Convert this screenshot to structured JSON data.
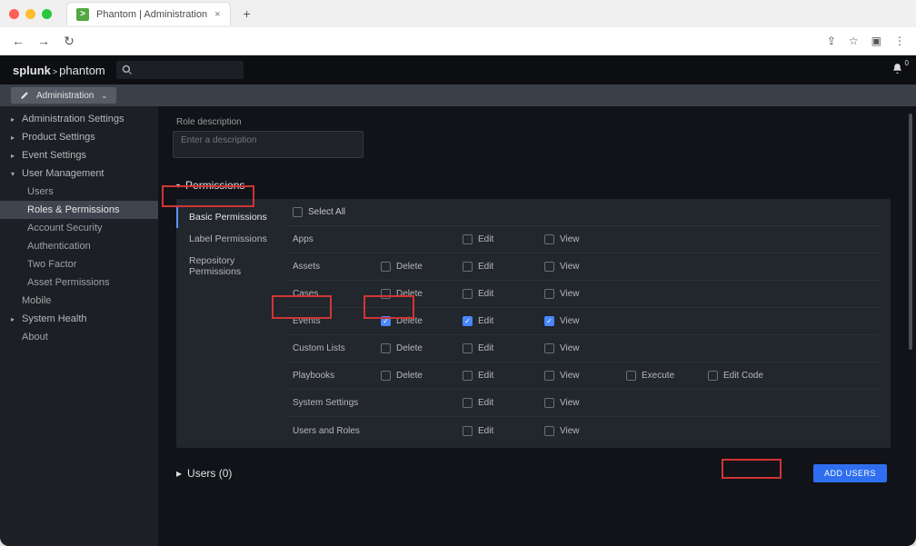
{
  "browser": {
    "tab_title": "Phantom | Administration",
    "favicon_char": ">"
  },
  "header": {
    "logo_a": "splunk",
    "logo_b": "phantom",
    "bell_count": "0"
  },
  "crumb": {
    "label": "Administration"
  },
  "sidebar": {
    "admin_settings": "Administration Settings",
    "product_settings": "Product Settings",
    "event_settings": "Event Settings",
    "user_mgmt": "User Management",
    "users": "Users",
    "roles": "Roles & Permissions",
    "acct_sec": "Account Security",
    "auth": "Authentication",
    "two_factor": "Two Factor",
    "asset_perm": "Asset Permissions",
    "mobile": "Mobile",
    "sys_health": "System Health",
    "about": "About"
  },
  "form": {
    "desc_label": "Role description",
    "desc_placeholder": "Enter a description"
  },
  "permissions": {
    "title": "Permissions",
    "tabs": {
      "basic": "Basic Permissions",
      "label": "Label Permissions",
      "repo": "Repository Permissions"
    },
    "select_all": "Select All",
    "cols": {
      "delete": "Delete",
      "edit": "Edit",
      "view": "View",
      "execute": "Execute",
      "editcode": "Edit Code"
    },
    "rows": {
      "apps": "Apps",
      "assets": "Assets",
      "cases": "Cases",
      "events": "Events",
      "custom_lists": "Custom Lists",
      "playbooks": "Playbooks",
      "sys_settings": "System Settings",
      "users_roles": "Users and Roles"
    }
  },
  "users": {
    "title": "Users (0)",
    "add_btn": "ADD USERS"
  }
}
